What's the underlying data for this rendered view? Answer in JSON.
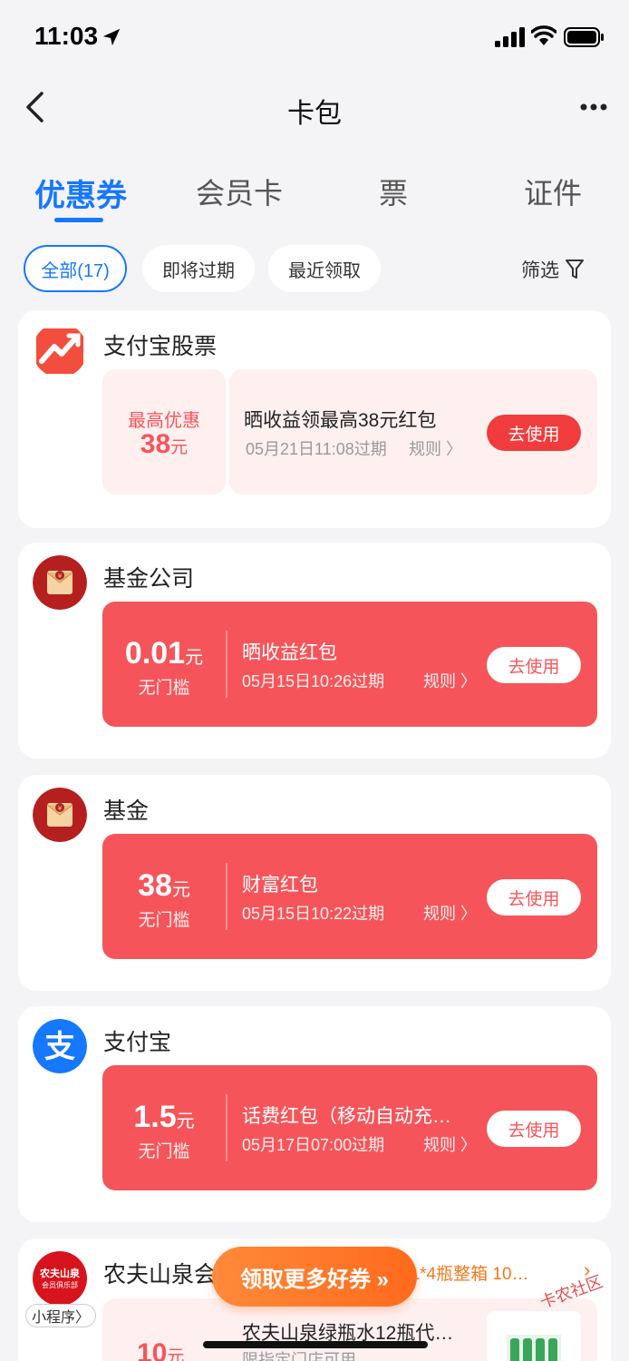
{
  "status": {
    "time": "11:03"
  },
  "nav": {
    "title": "卡包"
  },
  "tabs": [
    {
      "label": "优惠券",
      "active": true
    },
    {
      "label": "会员卡",
      "active": false
    },
    {
      "label": "票",
      "active": false
    },
    {
      "label": "证件",
      "active": false
    }
  ],
  "filters": {
    "chips": [
      {
        "label": "全部(17)",
        "active": true
      },
      {
        "label": "即将过期",
        "active": false
      },
      {
        "label": "最近领取",
        "active": false
      }
    ],
    "filter_label": "筛选"
  },
  "cards": [
    {
      "title": "支付宝股票",
      "amount_label": "最高优惠",
      "amount": "38",
      "unit": "元",
      "coupon_title": "晒收益领最高38元红包",
      "expiry": "05月21日11:08过期",
      "rule": "规则 〉",
      "button": "去使用"
    },
    {
      "title": "基金公司",
      "amount": "0.01",
      "unit": "元",
      "condition": "无门槛",
      "coupon_title": "晒收益红包",
      "expiry": "05月15日10:26过期",
      "rule": "规则 〉",
      "button": "去使用"
    },
    {
      "title": "基金",
      "amount": "38",
      "unit": "元",
      "condition": "无门槛",
      "coupon_title": "财富红包",
      "expiry": "05月15日10:22过期",
      "rule": "规则 〉",
      "button": "去使用"
    },
    {
      "title": "支付宝",
      "amount": "1.5",
      "unit": "元",
      "condition": "无门槛",
      "coupon_title": "话费红包（移动自动充…",
      "expiry": "05月17日07:00过期",
      "rule": "规则 〉",
      "button": "去使用"
    },
    {
      "title": "农夫山泉会员俱",
      "logo_text_line1": "农夫山泉",
      "logo_text_line2": "会员俱乐部",
      "badge": "小程序〉",
      "promo": "农夫山泉5L*4瓶整箱 10…",
      "amount": "10",
      "unit": "元",
      "coupon_title": "农夫山泉绿瓶水12瓶代…",
      "sub": "限指定门店可用"
    }
  ],
  "floating_button": "领取更多好券 »",
  "watermark": "卡农社区",
  "colors": {
    "primary": "#1677ff",
    "coupon_red": "#f5555a",
    "accent_orange": "#ff7a2a"
  }
}
